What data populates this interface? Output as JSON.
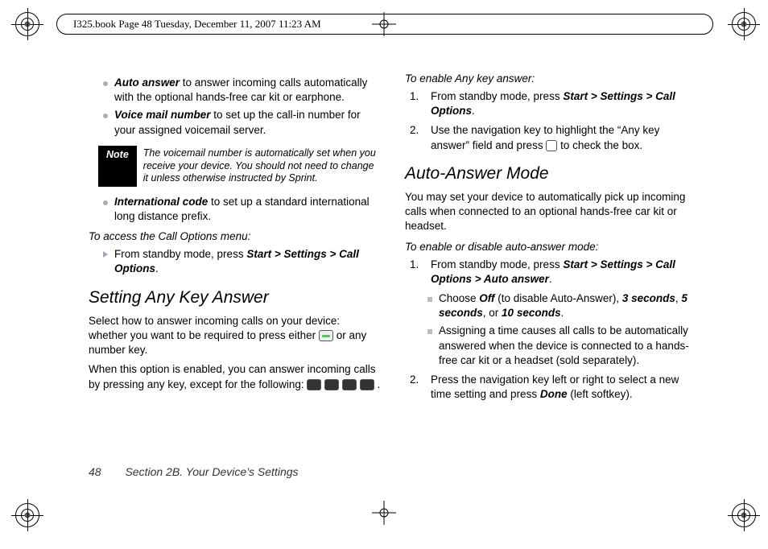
{
  "header": {
    "slug": "I325.book  Page 48  Tuesday, December 11, 2007  11:23 AM"
  },
  "left": {
    "auto_answer_term": "Auto answer",
    "auto_answer_txt": " to answer incoming calls automatically with the optional hands-free car kit or earphone.",
    "voicemail_term": "Voice mail number",
    "voicemail_txt": " to set up the call-in number for your assigned voicemail server.",
    "note_label": "Note",
    "note_body": "The voicemail number is automatically set when you receive your device. You should not need to change it unless otherwise instructed by Sprint.",
    "intl_term": "International code",
    "intl_txt": " to set up a standard international long distance prefix.",
    "access_line": "To access the Call Options menu:",
    "access_step_pre": "From standby mode, press ",
    "access_step_bold": "Start > Settings > Call Options",
    "access_step_post": ".",
    "h2": "Setting Any Key Answer",
    "p1_a": "Select how to answer incoming calls on your device: whether you want to be required to press either ",
    "p1_b": " or any number key.",
    "p2_a": "When this option is enabled, you can answer incoming calls by pressing any key, except for the following: ",
    "p2_b": "."
  },
  "right": {
    "enable_any_title": "To enable Any key answer:",
    "step1_pre": "From standby mode, press ",
    "step1_bold": "Start > Settings > Call Options",
    "step1_post": ".",
    "step2_a": "Use the navigation key to highlight the “Any key answer” field and press ",
    "step2_b": " to check the box.",
    "h2": "Auto-Answer Mode",
    "intro": "You may set your device to automatically pick up incoming calls when connected to an optional hands-free car kit or headset.",
    "enable_auto_title": "To enable or disable auto-answer mode:",
    "a_step1_pre": "From standby mode, press ",
    "a_step1_bold": "Start > Settings > Call Options > Auto answer",
    "a_step1_post": ".",
    "a_sub1_pre": "Choose ",
    "a_sub1_off": "Off",
    "a_sub1_mid": " (to disable Auto-Answer), ",
    "a_sub1_3s": "3 seconds",
    "a_sub1_c1": ", ",
    "a_sub1_5s": "5 seconds",
    "a_sub1_c2": ", or ",
    "a_sub1_10s": "10 seconds",
    "a_sub1_post": ".",
    "a_sub2": "Assigning a time causes all calls to be automatically answered when the device is connected to a hands-free car kit or a headset (sold separately).",
    "a_step2_pre": "Press the navigation key left or right to select a new time setting and press ",
    "a_step2_bold": "Done",
    "a_step2_post": " (left softkey)."
  },
  "footer": {
    "page": "48",
    "section": "Section 2B. Your Device’s Settings"
  }
}
